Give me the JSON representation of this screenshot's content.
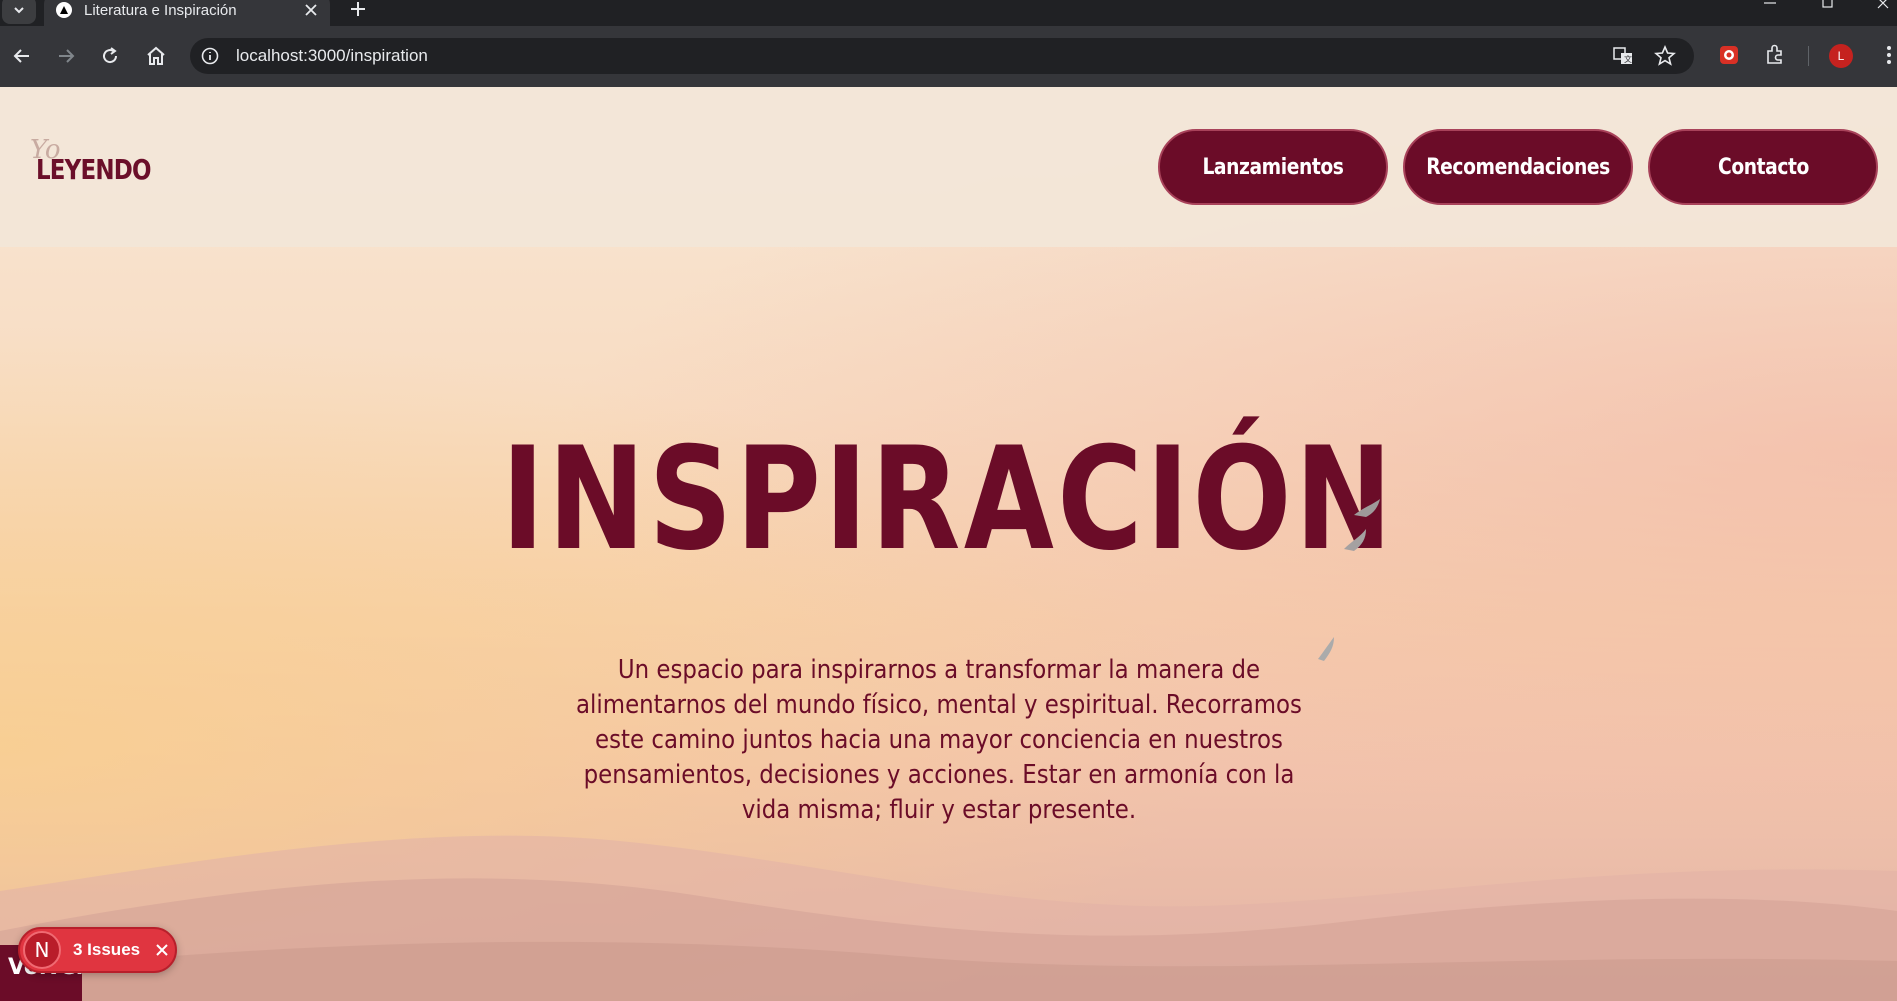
{
  "browser": {
    "tab_title": "Literatura e Inspiración",
    "url": "localhost:3000/inspiration",
    "avatar_letter": "L"
  },
  "site": {
    "logo_script": "Yo",
    "logo_text": "LEYENDO",
    "nav": [
      {
        "label": "Lanzamientos"
      },
      {
        "label": "Recomendaciones"
      },
      {
        "label": "Contacto"
      }
    ]
  },
  "hero": {
    "title": "INSPIRACIÓN",
    "description": "Un espacio para inspirarnos a transformar la manera de alimentarnos del mundo físico, mental y espiritual. Recorramos este camino juntos hacia una mayor conciencia en nuestros pensamientos, decisiones y acciones. Estar en armonía con la vida misma; fluir y estar presente."
  },
  "footer": {
    "back_label": "Volver"
  },
  "dev_overlay": {
    "badge_letter": "N",
    "issues_label": "3 Issues"
  },
  "colors": {
    "brand": "#6b0c28",
    "chrome_bg": "#35363a",
    "issues_red": "#e03540"
  }
}
